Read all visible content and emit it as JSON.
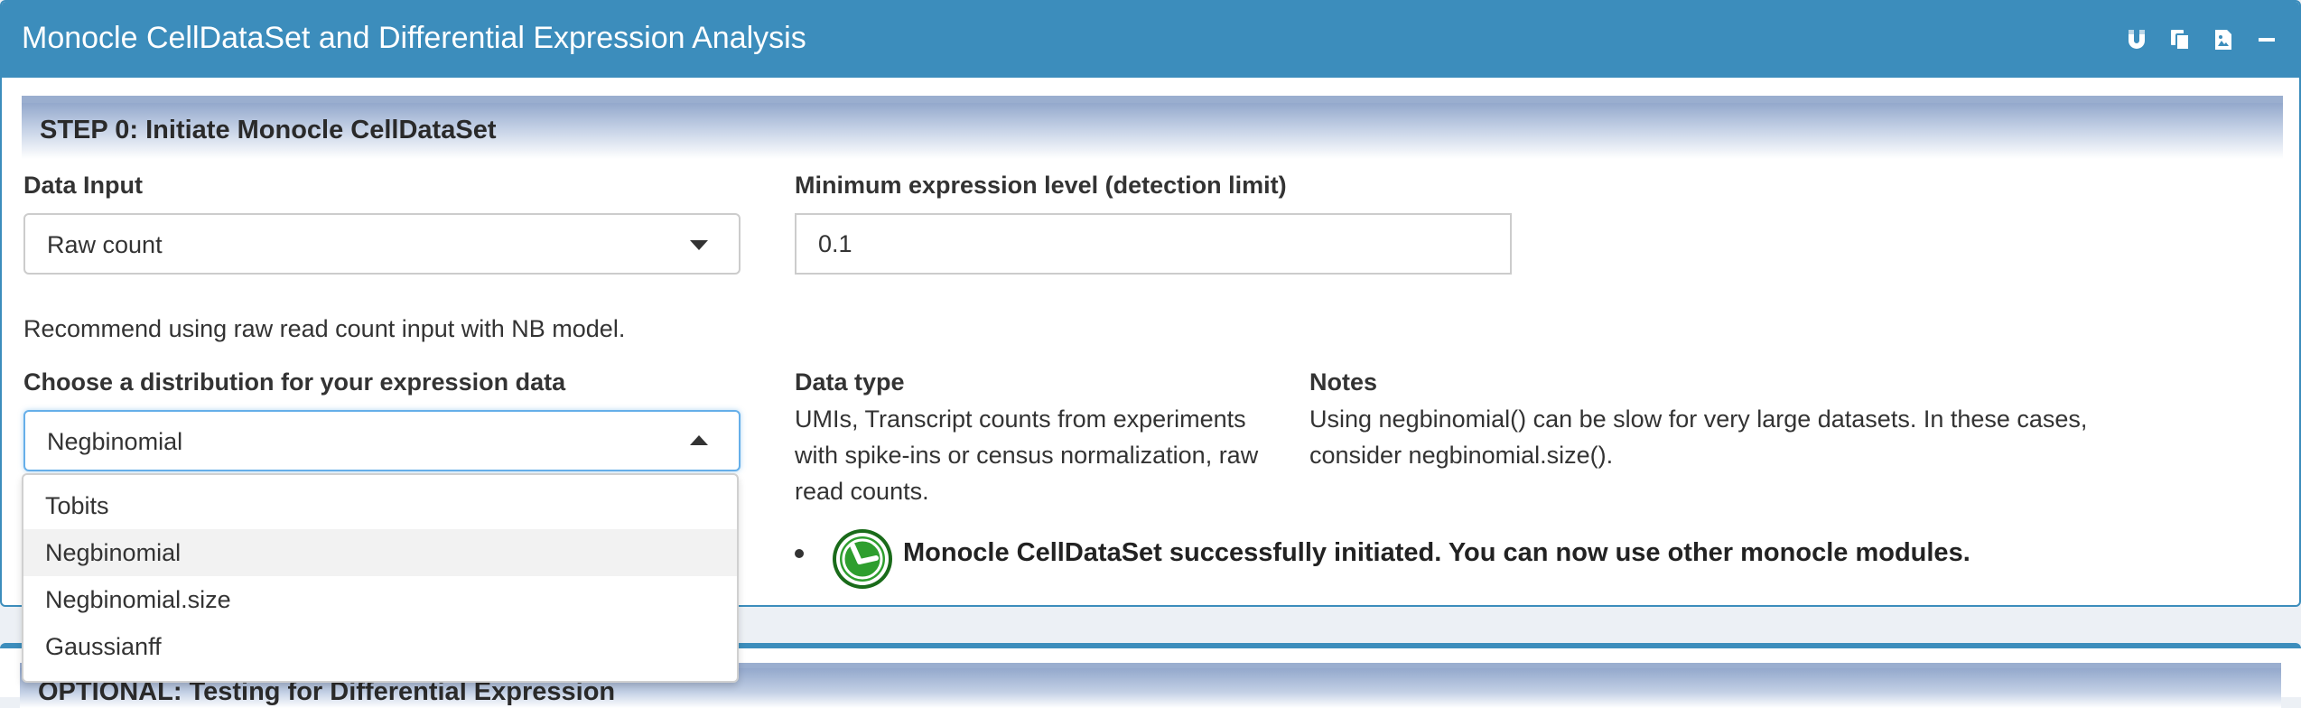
{
  "box": {
    "title": "Monocle CellDataSet and Differential Expression Analysis",
    "tools": [
      "magnet-icon",
      "copy-icon",
      "image-icon",
      "minus-icon"
    ]
  },
  "step0": {
    "title": "STEP 0: Initiate Monocle CellDataSet",
    "data_input": {
      "label": "Data Input",
      "selected": "Raw count"
    },
    "min_expr": {
      "label": "Minimum expression level (detection limit)",
      "value": "0.1"
    },
    "recommend_text": "Recommend using raw read count input with NB model.",
    "distribution": {
      "label": "Choose a distribution for your expression data",
      "selected": "Negbinomial",
      "options": [
        "Tobits",
        "Negbinomial",
        "Negbinomial.size",
        "Gaussianff"
      ],
      "selected_index": 1
    },
    "data_type": {
      "label": "Data type",
      "text": "UMIs, Transcript counts from experiments with spike-ins or census normalization, raw read counts."
    },
    "notes": {
      "label": "Notes",
      "text": "Using negbinomial() can be slow for very large datasets. In these cases, consider negbinomial.size()."
    },
    "success_text": "Monocle CellDataSet successfully initiated. You can now use other monocle modules."
  },
  "optional": {
    "title": "OPTIONAL: Testing for Differential Expression"
  },
  "colors": {
    "header_blue": "#3c8dbc",
    "success_green": "#2e9e2e",
    "page_bg": "#ecf0f5"
  }
}
